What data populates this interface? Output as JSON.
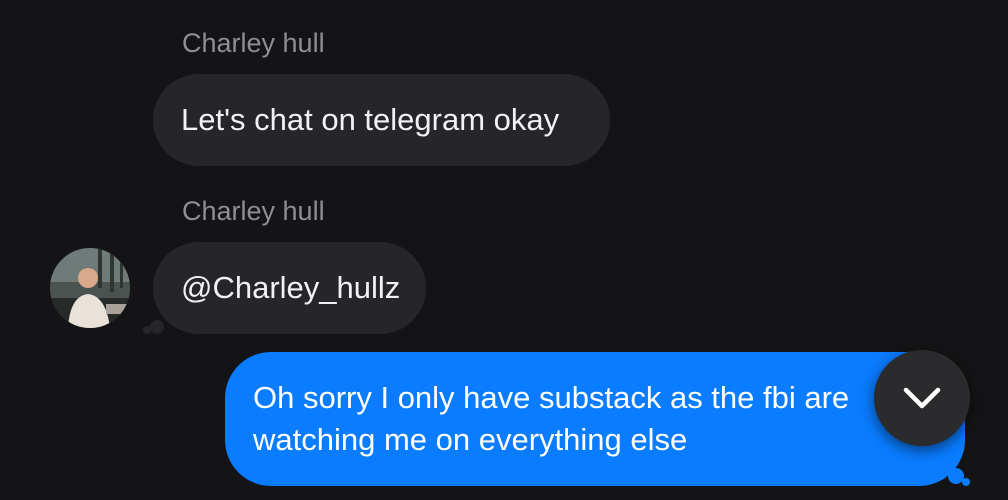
{
  "messages": [
    {
      "sender": "Charley hull",
      "text": "Let's chat on telegram okay",
      "direction": "incoming"
    },
    {
      "sender": "Charley hull",
      "text": "@Charley_hullz",
      "direction": "incoming"
    },
    {
      "text": "Oh sorry I only have substack as the fbi are watching me on everything else",
      "direction": "outgoing"
    }
  ],
  "scroll_button": {
    "icon": "chevron-down-icon"
  },
  "colors": {
    "background": "#141416",
    "incoming_bubble": "#262629",
    "outgoing_bubble": "#0a7cff",
    "sender_name": "#8e8e93"
  }
}
